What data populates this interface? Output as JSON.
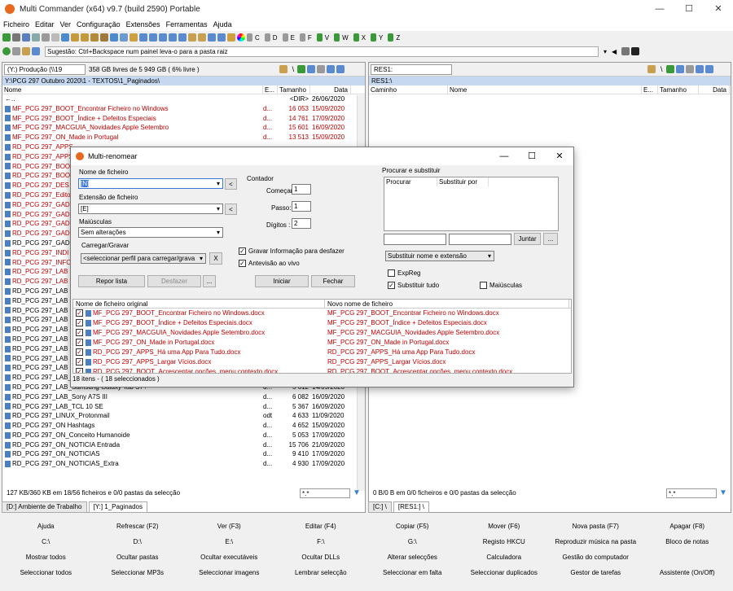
{
  "window": {
    "title": "Multi Commander (x64)  v9.7 (build 2590) Portable",
    "minimize": "—",
    "maximize": "☐",
    "close": "✕"
  },
  "menu": [
    "Ficheiro",
    "Editar",
    "Ver",
    "Configuração",
    "Extensões",
    "Ferramentas",
    "Ajuda"
  ],
  "toolbar": {
    "drives": [
      "C",
      "D",
      "E",
      "F",
      "V",
      "W",
      "X",
      "Y",
      "Z"
    ]
  },
  "suggestion": {
    "value": "Sugestão: Ctrl+Backspace num painel leva-o para a pasta raiz"
  },
  "left_panel": {
    "drive": "(Y:) Produção (\\\\19",
    "free": "358 GB livres de 5 949 GB ( 6% livre )",
    "path": "Y:\\PCG 297 Outubro 2020\\1 - TEXTOS\\1_Paginados\\",
    "columns": [
      "Nome",
      "E...",
      "Tamanho",
      "Data"
    ],
    "rows": [
      {
        "name": "←..",
        "ext": "",
        "size": "<DIR>",
        "date": "26/06/2020",
        "color": "bk"
      },
      {
        "name": "MF_PCG 297_BOOT_Encontrar Ficheiro no Windows",
        "ext": "d...",
        "size": "16 053",
        "date": "15/09/2020",
        "color": "red"
      },
      {
        "name": "MF_PCG 297_BOOT_Índice + Defeitos Especiais",
        "ext": "d...",
        "size": "14 761",
        "date": "17/09/2020",
        "color": "red"
      },
      {
        "name": "MF_PCG 297_MACGUIA_Novidades Apple Setembro",
        "ext": "d...",
        "size": "15 601",
        "date": "16/09/2020",
        "color": "red"
      },
      {
        "name": "MF_PCG 297_ON_Made in Portugal",
        "ext": "d...",
        "size": "13 513",
        "date": "15/09/2020",
        "color": "red"
      },
      {
        "name": "RD_PCG 297_APPS",
        "ext": "",
        "size": "",
        "date": "",
        "color": "red"
      },
      {
        "name": "RD_PCG 297_APPS",
        "ext": "",
        "size": "",
        "date": "",
        "color": "red"
      },
      {
        "name": "RD_PCG 297_BOO",
        "ext": "",
        "size": "",
        "date": "",
        "color": "red"
      },
      {
        "name": "RD_PCG 297_BOO",
        "ext": "",
        "size": "",
        "date": "",
        "color": "red"
      },
      {
        "name": "RD_PCG 297_DES",
        "ext": "",
        "size": "",
        "date": "",
        "color": "red"
      },
      {
        "name": "RD_PCG 297_Edito",
        "ext": "",
        "size": "",
        "date": "",
        "color": "red"
      },
      {
        "name": "RD_PCG 297_GAD",
        "ext": "",
        "size": "",
        "date": "",
        "color": "red"
      },
      {
        "name": "RD_PCG 297_GAD",
        "ext": "",
        "size": "",
        "date": "",
        "color": "red"
      },
      {
        "name": "RD_PCG 297_GAD",
        "ext": "",
        "size": "",
        "date": "",
        "color": "red"
      },
      {
        "name": "RD_PCG 297_GAD",
        "ext": "",
        "size": "",
        "date": "",
        "color": "red"
      },
      {
        "name": "RD_PCG 297_GAD",
        "ext": "",
        "size": "",
        "date": "",
        "color": "bk"
      },
      {
        "name": "RD_PCG 297_INDI",
        "ext": "",
        "size": "",
        "date": "",
        "color": "red"
      },
      {
        "name": "RD_PCG 297_INFO",
        "ext": "",
        "size": "",
        "date": "",
        "color": "red"
      },
      {
        "name": "RD_PCG 297_LAB",
        "ext": "",
        "size": "",
        "date": "",
        "color": "red"
      },
      {
        "name": "RD_PCG 297_LAB",
        "ext": "",
        "size": "",
        "date": "",
        "color": "red"
      },
      {
        "name": "RD_PCG 297_LAB",
        "ext": "",
        "size": "",
        "date": "",
        "color": "bk"
      },
      {
        "name": "RD_PCG 297_LAB",
        "ext": "",
        "size": "",
        "date": "",
        "color": "bk"
      },
      {
        "name": "RD_PCG 297_LAB",
        "ext": "",
        "size": "",
        "date": "",
        "color": "bk"
      },
      {
        "name": "RD_PCG 297_LAB",
        "ext": "",
        "size": "",
        "date": "",
        "color": "bk"
      },
      {
        "name": "RD_PCG 297_LAB",
        "ext": "",
        "size": "",
        "date": "",
        "color": "bk"
      },
      {
        "name": "RD_PCG 297_LAB",
        "ext": "",
        "size": "",
        "date": "",
        "color": "bk"
      },
      {
        "name": "RD_PCG 297_LAB",
        "ext": "",
        "size": "",
        "date": "",
        "color": "bk"
      },
      {
        "name": "RD_PCG 297_LAB",
        "ext": "",
        "size": "",
        "date": "",
        "color": "bk"
      },
      {
        "name": "RD_PCG 297_LAB",
        "ext": "",
        "size": "",
        "date": "",
        "color": "bk"
      },
      {
        "name": "RD_PCG 297_LAB_Samsung Galaxy Note20 Ultra",
        "ext": "d...",
        "size": "6 364",
        "date": "15/09/2020",
        "color": "bk"
      },
      {
        "name": "RD_PCG 297_LAB_Samsung Galaxy Tab S7+",
        "ext": "d...",
        "size": "5 612",
        "date": "14/09/2020",
        "color": "bk"
      },
      {
        "name": "RD_PCG 297_LAB_Sony A7S III",
        "ext": "d...",
        "size": "6 082",
        "date": "16/09/2020",
        "color": "bk"
      },
      {
        "name": "RD_PCG 297_LAB_TCL 10 SE",
        "ext": "d...",
        "size": "5 367",
        "date": "16/09/2020",
        "color": "bk"
      },
      {
        "name": "RD_PCG 297_LINUX_Protonmail",
        "ext": "odt",
        "size": "4 633",
        "date": "11/09/2020",
        "color": "bk"
      },
      {
        "name": "RD_PCG 297_ON Hashtags",
        "ext": "d...",
        "size": "4 652",
        "date": "15/09/2020",
        "color": "bk"
      },
      {
        "name": "RD_PCG 297_ON_Conceito Humanoide",
        "ext": "d...",
        "size": "5 053",
        "date": "17/09/2020",
        "color": "bk"
      },
      {
        "name": "RD_PCG 297_ON_NOTICIA Entrada",
        "ext": "d...",
        "size": "15 706",
        "date": "21/09/2020",
        "color": "bk"
      },
      {
        "name": "RD_PCG 297_ON_NOTICIAS",
        "ext": "d...",
        "size": "9 410",
        "date": "17/09/2020",
        "color": "bk"
      },
      {
        "name": "RD_PCG 297_ON_NOTICIAS_Extra",
        "ext": "d...",
        "size": "4 930",
        "date": "17/09/2020",
        "color": "bk"
      }
    ],
    "status": "127 KB/360 KB em 18/56 ficheiros e 0/0 pastas da selecção",
    "filter": "*.*",
    "tabs": [
      "[D:] Ambiente de Trabalho",
      "[Y:] 1_Paginados"
    ]
  },
  "right_panel": {
    "drive": "RES1:",
    "path": "RES1:\\",
    "columns": [
      "Caminho",
      "Nome",
      "E...",
      "Tamanho",
      "Data"
    ],
    "status": "0 B/0 B em 0/0 ficheiros e 0/0 pastas da selecção",
    "filter": "*.*",
    "tabs": [
      "[C:] \\",
      "[RES1:] \\"
    ]
  },
  "fkeys": [
    "Ajuda",
    "Refrescar (F2)",
    "Ver (F3)",
    "Editar (F4)",
    "Copiar (F5)",
    "Mover (F6)",
    "Nova pasta (F7)",
    "Apagar (F8)",
    "C:\\",
    "D:\\",
    "E:\\",
    "F:\\",
    "G:\\",
    "Registo HKCU",
    "Reproduzir música na pasta",
    "Bloco de notas",
    "Mostrar todos",
    "Ocultar pastas",
    "Ocultar executáveis",
    "Ocultar DLLs",
    "Alterar selecções",
    "Calculadora",
    "Gestão do computador",
    "",
    "Seleccionar todos",
    "Seleccionar MP3s",
    "Seleccionar imagens",
    "Lembrar selecção",
    "Seleccionar em falta",
    "Seleccionar duplicados",
    "Gestor de tarefas",
    "Assistente (On/Off)"
  ],
  "dialog": {
    "title": "Multi-renomear",
    "filename_label": "Nome de ficheiro",
    "filename_value": "[N]",
    "ext_label": "Extensão de ficheiro",
    "ext_value": "[E]",
    "case_label": "Maiúsculas",
    "case_value": "Sem alterações",
    "load_save_label": "Carregar/Gravar",
    "profile_value": "<seleccionar perfil para carregar/grava",
    "arrow_btn": "<",
    "x_btn": "X",
    "counter_label": "Contador",
    "start_label": "Começar",
    "start_value": "1",
    "step_label": "Passo:",
    "step_value": "1",
    "digits_label": "Dígitos :",
    "digits_value": "2",
    "save_undo_label": "Gravar Informação para desfazer",
    "live_preview_label": "Antevisão ao vivo",
    "reset_btn": "Repor lista",
    "undo_btn": "Desfazer",
    "more_btn": "...",
    "start_btn": "Iniciar",
    "close_btn": "Fechar",
    "search_replace_label": "Procurar e substituir",
    "search_col": "Procurar",
    "replace_col": "Substituir por",
    "join_btn": "Juntar",
    "replace_mode": "Substituir nome e extensão",
    "regex_label": "ExpReg",
    "replace_all_label": "Substituir tudo",
    "case_chk_label": "Maiúsculas",
    "list_col_orig": "Nome de ficheiro original",
    "list_col_new": "Novo nome de ficheiro",
    "files": [
      {
        "orig": "MF_PCG 297_BOOT_Encontrar Ficheiro no Windows.docx",
        "new": "MF_PCG 297_BOOT_Encontrar Ficheiro no Windows.docx"
      },
      {
        "orig": "MF_PCG 297_BOOT_Índice + Defeitos Especiais.docx",
        "new": "MF_PCG 297_BOOT_Índice + Defeitos Especiais.docx"
      },
      {
        "orig": "MF_PCG 297_MACGUIA_Novidades Apple Setembro.docx",
        "new": "MF_PCG 297_MACGUIA_Novidades Apple Setembro.docx"
      },
      {
        "orig": "MF_PCG 297_ON_Made in Portugal.docx",
        "new": "MF_PCG 297_ON_Made in Portugal.docx"
      },
      {
        "orig": "RD_PCG 297_APPS_Há uma App Para Tudo.docx",
        "new": "RD_PCG 297_APPS_Há uma App Para Tudo.docx"
      },
      {
        "orig": "RD_PCG 297_APPS_Largar Vícios.docx",
        "new": "RD_PCG 297_APPS_Largar Vícios.docx"
      },
      {
        "orig": "RD_PCG 297_BOOT_Acrescentar opções, menu contexto.docx",
        "new": "RD_PCG 297_BOOT_Acrescentar opções, menu contexto.docx"
      }
    ],
    "status": "18 itens - ( 18 seleccionados )"
  }
}
